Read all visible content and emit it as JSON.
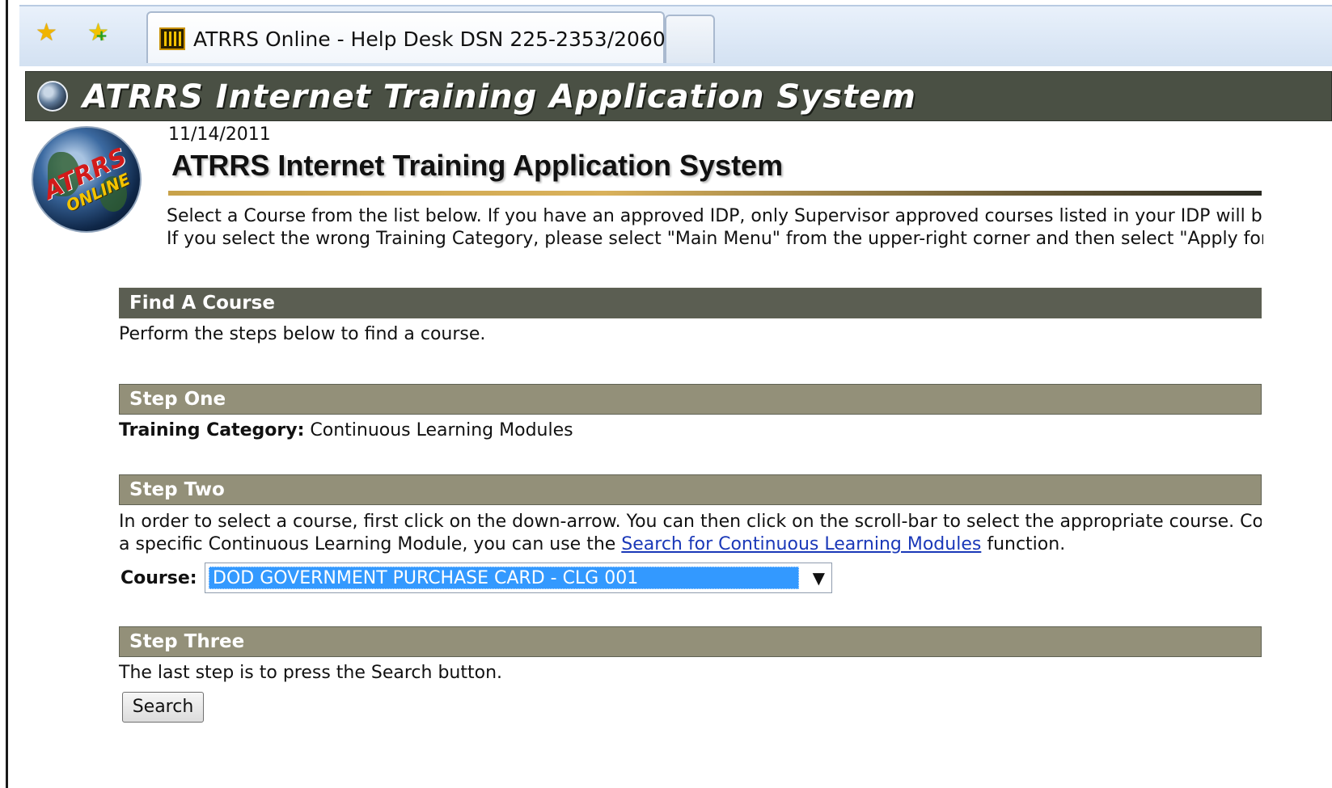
{
  "browser": {
    "favorites_icon": "favorites-star-icon",
    "add_favorite_icon": "add-to-favorites-icon",
    "tab_icon": "atrrs-site-icon",
    "tab_title": "ATRRS Online - Help Desk DSN 225-2353/2060"
  },
  "header": {
    "banner_title": "ATRRS Internet Training Application System",
    "logo_text_top": "ATRRS",
    "logo_text_bottom": "ONLINE",
    "date": "11/14/2011",
    "page_title": "ATRRS Internet Training Application System",
    "intro_line1": "Select a Course from the list below. If you have an approved IDP, only Supervisor approved courses listed in your IDP will be displa",
    "intro_line2": "If you select the wrong Training Category, please select \"Main Menu\" from the upper-right corner and then select \"Apply for Trainin"
  },
  "find": {
    "title": "Find A Course",
    "text": "Perform the steps below to find a course."
  },
  "step1": {
    "title": "Step One",
    "label": "Training Category:",
    "value": "Continuous Learning Modules"
  },
  "step2": {
    "title": "Step Two",
    "line1": "In order to select a course, first click on the down-arrow. You can then click on the scroll-bar to select the appropriate course. Courses a",
    "line2_pre": "a specific Continuous Learning Module, you can use the ",
    "link": "Search for Continuous Learning Modules",
    "line2_post": " function.",
    "course_label": "Course:",
    "course_value": "DOD GOVERNMENT PURCHASE CARD - CLG 001"
  },
  "step3": {
    "title": "Step Three",
    "text": "The last step is to press the Search button.",
    "button": "Search"
  },
  "colors": {
    "banner": "#4a5044",
    "bar_dark": "#5b5e52",
    "bar_light": "#939079",
    "selection": "#3399ff",
    "link": "#1a38b8"
  }
}
